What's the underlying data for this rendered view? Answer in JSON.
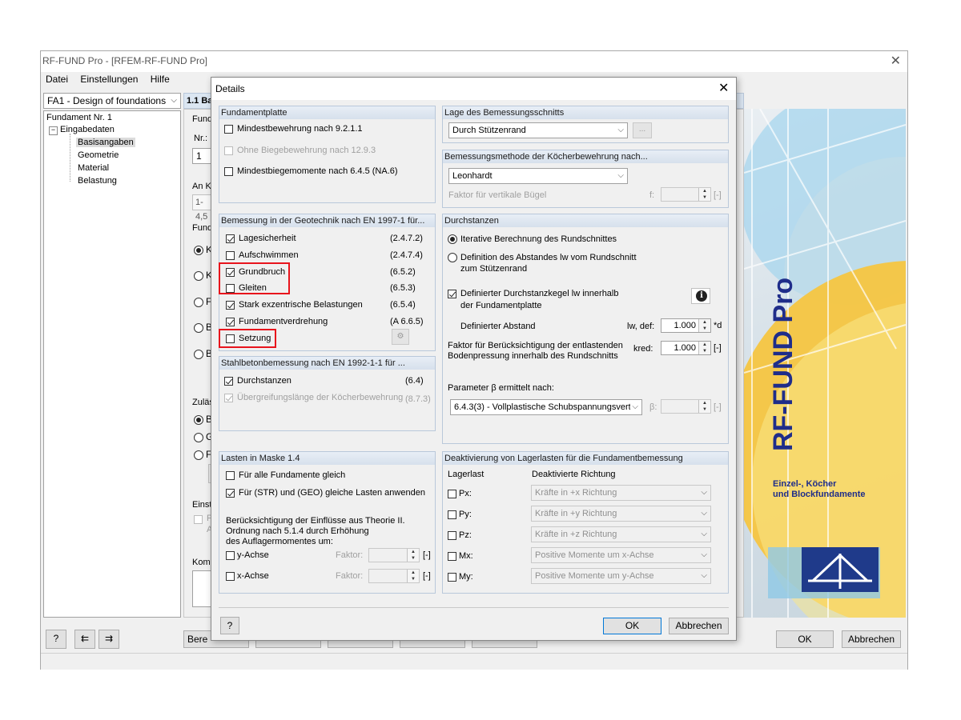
{
  "main": {
    "title": "RF-FUND Pro - [RFEM-RF-FUND Pro]",
    "menu": [
      "Datei",
      "Einstellungen",
      "Hilfe"
    ],
    "case_select": "FA1 - Design of foundations",
    "tree": {
      "root": "Fundament Nr. 1",
      "group": "Eingabedaten",
      "items": [
        "Basisangaben",
        "Geometrie",
        "Material",
        "Belastung"
      ]
    },
    "panel_header": "1.1 Ba",
    "partial_labels": [
      "Fund",
      "Nr.:",
      "1",
      "An K",
      "1-4,5",
      "Fund",
      "K",
      "K",
      "Fl",
      "B",
      "B",
      "Zuläs",
      "B",
      "G",
      "Fl",
      "Einst",
      "P",
      "A",
      "Komr"
    ],
    "bottom_left_button": "Bere",
    "ok": "OK",
    "cancel": "Abbrechen"
  },
  "banner": {
    "title": "RF-FUND Pro",
    "subtitle_line1": "Einzel-, Köcher",
    "subtitle_line2": "und Blockfundamente"
  },
  "dialog": {
    "title": "Details",
    "ok": "OK",
    "cancel": "Abbrechen",
    "fundamentplatte": {
      "header": "Fundamentplatte",
      "items": [
        {
          "label": "Mindestbewehrung nach 9.2.1.1",
          "checked": false,
          "enabled": true
        },
        {
          "label": "Ohne Biegebewehrung nach 12.9.3",
          "checked": false,
          "enabled": false
        },
        {
          "label": "Mindestbiegemomente nach 6.4.5 (NA.6)",
          "checked": false,
          "enabled": true
        }
      ]
    },
    "geotechnik": {
      "header": "Bemessung in der Geotechnik nach EN 1997-1 für...",
      "items": [
        {
          "label": "Lagesicherheit",
          "ref": "(2.4.7.2)",
          "checked": true
        },
        {
          "label": "Aufschwimmen",
          "ref": "(2.4.7.4)",
          "checked": false
        },
        {
          "label": "Grundbruch",
          "ref": "(6.5.2)",
          "checked": true
        },
        {
          "label": "Gleiten",
          "ref": "(6.5.3)",
          "checked": false
        },
        {
          "label": "Stark exzentrische Belastungen",
          "ref": "(6.5.4)",
          "checked": true
        },
        {
          "label": "Fundamentverdrehung",
          "ref": "(A 6.6.5)",
          "checked": true
        },
        {
          "label": "Setzung",
          "ref": "",
          "checked": false
        }
      ]
    },
    "stahlbeton": {
      "header": "Stahlbetonbemessung nach EN 1992-1-1 für ...",
      "items": [
        {
          "label": "Durchstanzen",
          "ref": "(6.4)",
          "checked": true,
          "enabled": true
        },
        {
          "label": "Übergreifungslänge der Köcherbewehrung",
          "ref": "(8.7.3)",
          "checked": true,
          "enabled": false
        }
      ]
    },
    "lasten": {
      "header": "Lasten in Maske 1.4",
      "items": [
        {
          "label": "Für alle Fundamente gleich",
          "checked": false
        },
        {
          "label": "Für (STR) und (GEO) gleiche Lasten anwenden",
          "checked": true
        }
      ],
      "theorie_text": [
        "Berücksichtigung der Einflüsse aus Theorie II.",
        "Ordnung nach 5.1.4 durch Erhöhung",
        "des Auflagermomentes um:"
      ],
      "axes": [
        {
          "label": "y-Achse",
          "factor_label": "Faktor:",
          "unit": "[-]",
          "checked": false
        },
        {
          "label": "x-Achse",
          "factor_label": "Faktor:",
          "unit": "[-]",
          "checked": false
        }
      ]
    },
    "lage": {
      "header": "Lage des Bemessungsschnitts",
      "value": "Durch Stützenrand",
      "button": "..."
    },
    "methode": {
      "header": "Bemessungsmethode der Köcherbewehrung nach...",
      "value": "Leonhardt",
      "faktor_label": "Faktor für vertikale Bügel",
      "faktor_symbol": "f:",
      "unit": "[-]"
    },
    "durchstanzen": {
      "header": "Durchstanzen",
      "radio1": "Iterative Berechnung des Rundschnittes",
      "radio2_line1": "Definition des Abstandes lw vom Rundschnitt",
      "radio2_line2": "zum Stützenrand",
      "kegel_line1": "Definierter Durchstanzkegel lw innerhalb",
      "kegel_line2": "der Fundamentplatte",
      "abstand_label": "Definierter Abstand",
      "abstand_symbol": "lw, def:",
      "abstand_value": "1.000",
      "abstand_unit": "*d",
      "faktor_line1": "Faktor für Berücksichtigung der entlastenden",
      "faktor_line2": "Bodenpressung innerhalb des Rundschnitts",
      "kred_symbol": "kred:",
      "kred_value": "1.000",
      "kred_unit": "[-]",
      "parameter_label": "Parameter β ermittelt nach:",
      "parameter_value": "6.4.3(3) - Vollplastische Schubspannungsverte",
      "beta_symbol": "β:",
      "beta_unit": "[-]"
    },
    "deaktivierung": {
      "header": "Deaktivierung von Lagerlasten für die Fundamentbemessung",
      "col1": "Lagerlast",
      "col2": "Deaktivierte Richtung",
      "rows": [
        {
          "label": "Px:",
          "value": "Kräfte in +x Richtung"
        },
        {
          "label": "Py:",
          "value": "Kräfte in +y Richtung"
        },
        {
          "label": "Pz:",
          "value": "Kräfte in +z Richtung"
        },
        {
          "label": "Mx:",
          "value": "Positive Momente um x-Achse"
        },
        {
          "label": "My:",
          "value": "Positive Momente um y-Achse"
        }
      ]
    }
  }
}
